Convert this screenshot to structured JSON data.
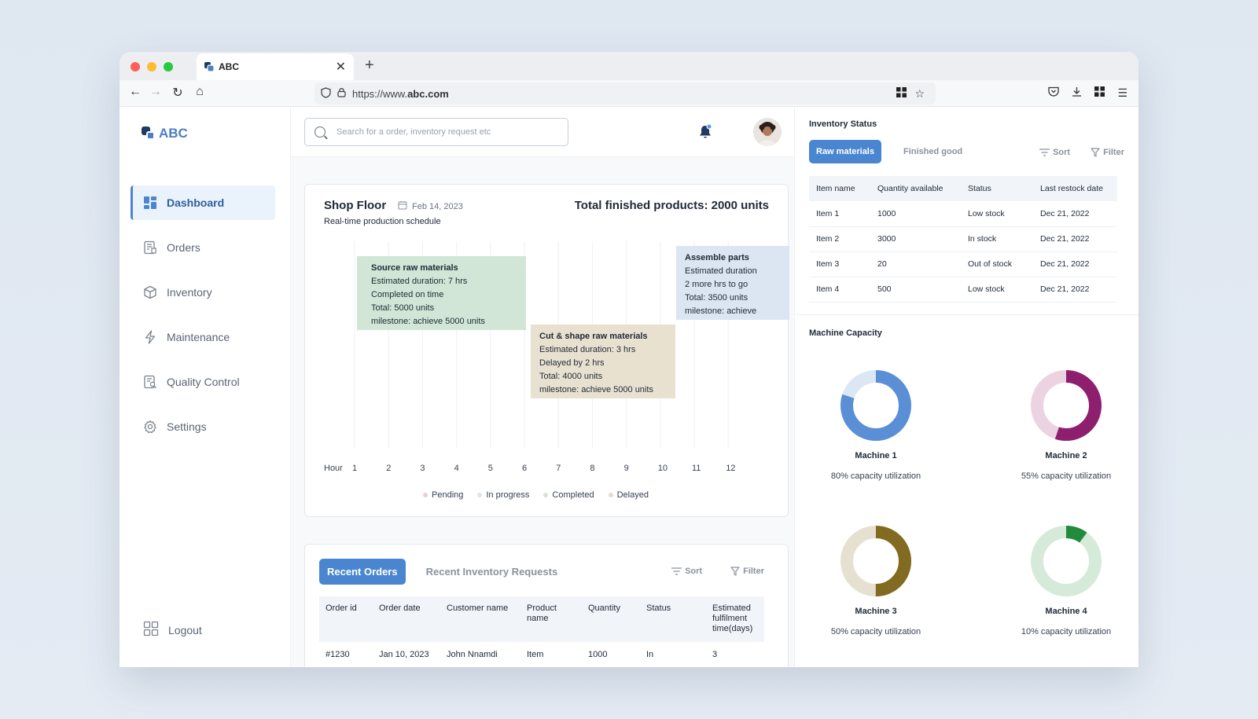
{
  "browser": {
    "tab_title": "ABC",
    "url_prefix": "https://www.",
    "url_domain": "abc.com"
  },
  "brand": {
    "name": "ABC",
    "primary_color": "#4a86cf",
    "dark_color": "#1f3b63"
  },
  "sidebar": {
    "items": [
      {
        "label": "Dashboard",
        "icon": "dashboard-icon",
        "active": true
      },
      {
        "label": "Orders",
        "icon": "orders-icon",
        "active": false
      },
      {
        "label": "Inventory",
        "icon": "box-icon",
        "active": false
      },
      {
        "label": "Maintenance",
        "icon": "bolt-icon",
        "active": false
      },
      {
        "label": "Quality Control",
        "icon": "report-icon",
        "active": false
      },
      {
        "label": "Settings",
        "icon": "gear-icon",
        "active": false
      }
    ],
    "logout_label": "Logout"
  },
  "search": {
    "placeholder": "Search for a order, inventory request etc",
    "value": ""
  },
  "shop_floor": {
    "title": "Shop Floor",
    "date": "Feb 14, 2023",
    "subtitle": "Real-time production schedule",
    "total": "Total finished products: 2000 units",
    "hour_label": "Hour",
    "hours": [
      "1",
      "2",
      "3",
      "4",
      "5",
      "6",
      "7",
      "8",
      "9",
      "10",
      "11",
      "12"
    ],
    "tasks": [
      {
        "title": "Source raw materials",
        "lines": [
          "Estimated duration: 7 hrs",
          "Completed on time",
          "Total: 5000 units",
          "milestone: achieve 5000 units"
        ],
        "status": "Completed",
        "color": "#d1e6d6"
      },
      {
        "title": "Cut & shape raw materials",
        "lines": [
          "Estimated duration: 3 hrs",
          "Delayed by 2 hrs",
          "Total: 4000 units",
          "milestone: achieve 5000 units"
        ],
        "status": "Delayed",
        "color": "#e9e1d0"
      },
      {
        "title": "Assemble parts",
        "lines": [
          "Estimated duration",
          "2 more hrs to go",
          "Total: 3500 units",
          "milestone: achieve"
        ],
        "status": "In progress",
        "color": "#dbe6f2"
      }
    ],
    "legend": [
      {
        "label": "Pending",
        "color": "#e6d1dc"
      },
      {
        "label": "In progress",
        "color": "#dbe6f2"
      },
      {
        "label": "Completed",
        "color": "#d1e6d6"
      },
      {
        "label": "Delayed",
        "color": "#e4dccc"
      }
    ]
  },
  "recent": {
    "tabs": [
      "Recent Orders",
      "Recent Inventory Requests"
    ],
    "sort_label": "Sort",
    "filter_label": "Filter",
    "columns": [
      "Order id",
      "Order date",
      "Customer name",
      "Product name",
      "Quantity",
      "Status",
      "Estimated fulfilment time(days)"
    ],
    "rows": [
      [
        "#1230",
        "Jan 10, 2023",
        "John Nnamdi",
        "Item",
        "1000",
        "In",
        "3"
      ]
    ]
  },
  "inventory": {
    "title": "Inventory Status",
    "tabs": [
      "Raw materials",
      "Finished good"
    ],
    "sort_label": "Sort",
    "filter_label": "Filter",
    "columns": [
      "Item name",
      "Quantity available",
      "Status",
      "Last restock date"
    ],
    "rows": [
      [
        "Item 1",
        "1000",
        "Low stock",
        "Dec 21, 2022"
      ],
      [
        "Item 2",
        "3000",
        "In stock",
        "Dec 21, 2022"
      ],
      [
        "Item 3",
        "20",
        "Out of stock",
        "Dec 21, 2022"
      ],
      [
        "Item 4",
        "500",
        "Low stock",
        "Dec 21, 2022"
      ]
    ]
  },
  "capacity": {
    "title": "Machine Capacity",
    "machines": [
      {
        "name": "Machine 1",
        "label": "80% capacity utilization",
        "utilization": 0.8,
        "color": "#5a8fd6",
        "track": "#dce7f4"
      },
      {
        "name": "Machine 2",
        "label": "55% capacity utilization",
        "utilization": 0.55,
        "color": "#8e1f6e",
        "track": "#ecd3e2"
      },
      {
        "name": "Machine 3",
        "label": "50% capacity utilization",
        "utilization": 0.5,
        "color": "#836a21",
        "track": "#e6e0d0"
      },
      {
        "name": "Machine 4",
        "label": "10% capacity utilization",
        "utilization": 0.1,
        "color": "#228a3b",
        "track": "#d6ead9"
      }
    ]
  }
}
